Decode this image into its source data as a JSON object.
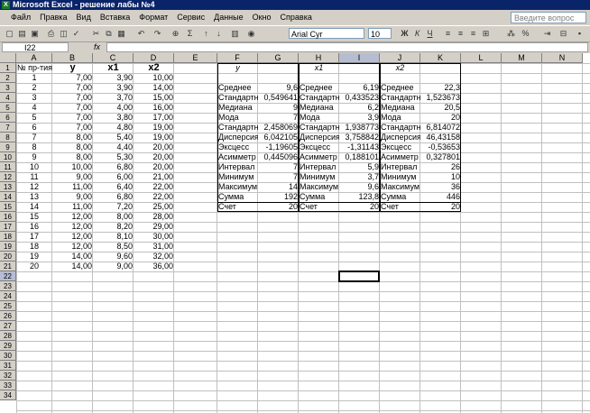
{
  "window": {
    "title": "Microsoft Excel - решение лабы №4"
  },
  "menu": [
    "Файл",
    "Правка",
    "Вид",
    "Вставка",
    "Формат",
    "Сервис",
    "Данные",
    "Окно",
    "Справка"
  ],
  "help_placeholder": "Введите вопрос",
  "toolbar": {
    "font": "Arial Cyr",
    "size": "10"
  },
  "namebox": "I22",
  "fx": "fx",
  "columns": [
    "A",
    "B",
    "C",
    "D",
    "E",
    "F",
    "G",
    "H",
    "I",
    "J",
    "K",
    "L",
    "M",
    "N"
  ],
  "rows_count": 34,
  "headers": {
    "A": "№ пр-тия",
    "B": "y",
    "C": "x1",
    "D": "x2",
    "F": "y",
    "H": "x1",
    "J": "x2"
  },
  "table": [
    [
      "1",
      "7,00",
      "3,90",
      "10,00"
    ],
    [
      "2",
      "7,00",
      "3,90",
      "14,00"
    ],
    [
      "3",
      "7,00",
      "3,70",
      "15,00"
    ],
    [
      "4",
      "7,00",
      "4,00",
      "16,00"
    ],
    [
      "5",
      "7,00",
      "3,80",
      "17,00"
    ],
    [
      "6",
      "7,00",
      "4,80",
      "19,00"
    ],
    [
      "7",
      "8,00",
      "5,40",
      "19,00"
    ],
    [
      "8",
      "8,00",
      "4,40",
      "20,00"
    ],
    [
      "9",
      "8,00",
      "5,30",
      "20,00"
    ],
    [
      "10",
      "10,00",
      "6,80",
      "20,00"
    ],
    [
      "11",
      "9,00",
      "6,00",
      "21,00"
    ],
    [
      "12",
      "11,00",
      "6,40",
      "22,00"
    ],
    [
      "13",
      "9,00",
      "6,80",
      "22,00"
    ],
    [
      "14",
      "11,00",
      "7,20",
      "25,00"
    ],
    [
      "15",
      "12,00",
      "8,00",
      "28,00"
    ],
    [
      "16",
      "12,00",
      "8,20",
      "29,00"
    ],
    [
      "17",
      "12,00",
      "8,10",
      "30,00"
    ],
    [
      "18",
      "12,00",
      "8,50",
      "31,00"
    ],
    [
      "19",
      "14,00",
      "9,60",
      "32,00"
    ],
    [
      "20",
      "14,00",
      "9,00",
      "36,00"
    ]
  ],
  "stats_labels": [
    "Среднее",
    "Стандартн",
    "Медиана",
    "Мода",
    "Стандартн",
    "Дисперсия",
    "Эксцесс",
    "Асимметр",
    "Интервал",
    "Минимум",
    "Максимум",
    "Сумма",
    "Счет"
  ],
  "stats_y": [
    "9,6",
    "0,549641",
    "9",
    "7",
    "2,458069",
    "6,042105",
    "-1,19605",
    "0,445096",
    "7",
    "7",
    "14",
    "192",
    "20"
  ],
  "stats_x1": [
    "6,19",
    "0,433523",
    "6,2",
    "3,9",
    "1,938773",
    "3,758842",
    "-1,31143",
    "0,188101",
    "5,9",
    "3,7",
    "9,6",
    "123,8",
    "20"
  ],
  "stats_x2": [
    "22,3",
    "1,523673",
    "20,5",
    "20",
    "6,814072",
    "46,43158",
    "-0,53653",
    "0,327801",
    "26",
    "10",
    "36",
    "446",
    "20"
  ]
}
